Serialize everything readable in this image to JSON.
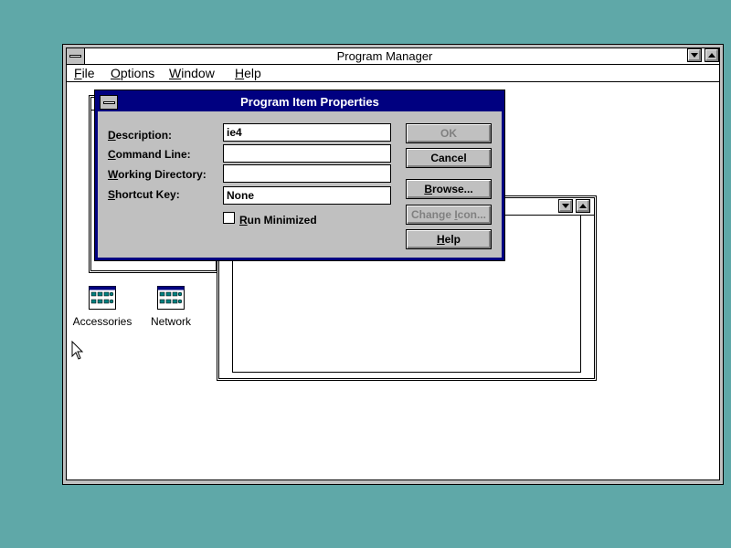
{
  "window": {
    "title": "Program Manager"
  },
  "menu": [
    "File",
    "Options",
    "Window",
    "Help"
  ],
  "icons": [
    {
      "label": "Accessories",
      "name": "accessories-group-icon"
    },
    {
      "label": "Network",
      "name": "network-group-icon"
    }
  ],
  "dialog": {
    "title": "Program Item Properties",
    "fields": [
      {
        "label": "Description:",
        "value": "ie4"
      },
      {
        "label": "Command Line:",
        "value": ""
      },
      {
        "label": "Working Directory:",
        "value": ""
      },
      {
        "label": "Shortcut Key:",
        "value": "None"
      }
    ],
    "checkbox": {
      "label": "Run Minimized",
      "checked": false
    },
    "buttons": {
      "ok": "OK",
      "cancel": "Cancel",
      "browse": "Browse...",
      "change_icon": "Change Icon...",
      "help": "Help"
    }
  },
  "colors": {
    "desktop": "#5fa8a8",
    "title_active": "#000080",
    "face": "#c0c0c0"
  }
}
